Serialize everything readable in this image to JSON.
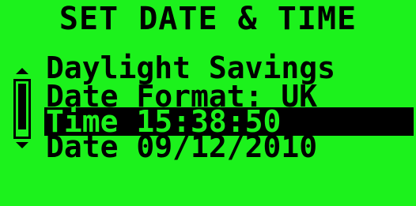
{
  "screen": {
    "title": "SET DATE & TIME",
    "background_color": "#1cf21c",
    "foreground_color": "#000000"
  },
  "menu": {
    "items": [
      {
        "label": "Daylight Savings",
        "selected": false
      },
      {
        "label": "Date Format: UK",
        "selected": false
      },
      {
        "label": "Time 15:38:50",
        "selected": true
      },
      {
        "label": "Date 09/12/2010",
        "selected": false
      }
    ]
  },
  "scrollbar": {
    "up_icon": "arrow-up-icon",
    "down_icon": "arrow-down-icon"
  }
}
